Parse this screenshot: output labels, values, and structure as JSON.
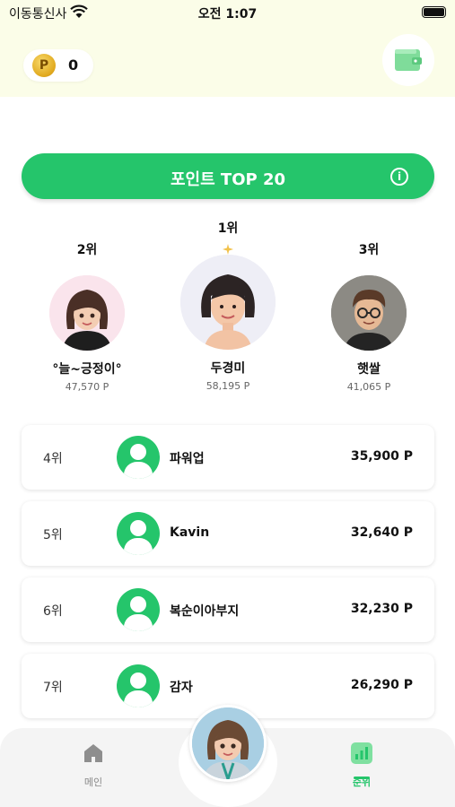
{
  "status_bar": {
    "carrier": "이동통신사",
    "time": "오전 1:07"
  },
  "header": {
    "coin_symbol": "P",
    "coin_balance": "0",
    "wallet_icon": "wallet-icon"
  },
  "title_bar": {
    "title": "포인트 TOP 20",
    "info_icon": "info-icon"
  },
  "podium": {
    "first": {
      "rank": "1위",
      "name": "두경미",
      "points": "58,195 P"
    },
    "second": {
      "rank": "2위",
      "name": "°늘~긍정이°",
      "points": "47,570 P"
    },
    "third": {
      "rank": "3위",
      "name": "햇쌀",
      "points": "41,065 P"
    }
  },
  "ranking_list": [
    {
      "rank": "4위",
      "name": "파워업",
      "points": "35,900 P"
    },
    {
      "rank": "5위",
      "name": "Kavin",
      "points": "32,640 P"
    },
    {
      "rank": "6위",
      "name": "복순이아부지",
      "points": "32,230 P"
    },
    {
      "rank": "7위",
      "name": "감자",
      "points": "26,290 P"
    }
  ],
  "tab_bar": {
    "home_label": "메인",
    "ranking_label": "순위"
  },
  "colors": {
    "accent": "#25c56b",
    "header_bg": "#fbfde8",
    "tab_bg": "#f4f4f4"
  }
}
